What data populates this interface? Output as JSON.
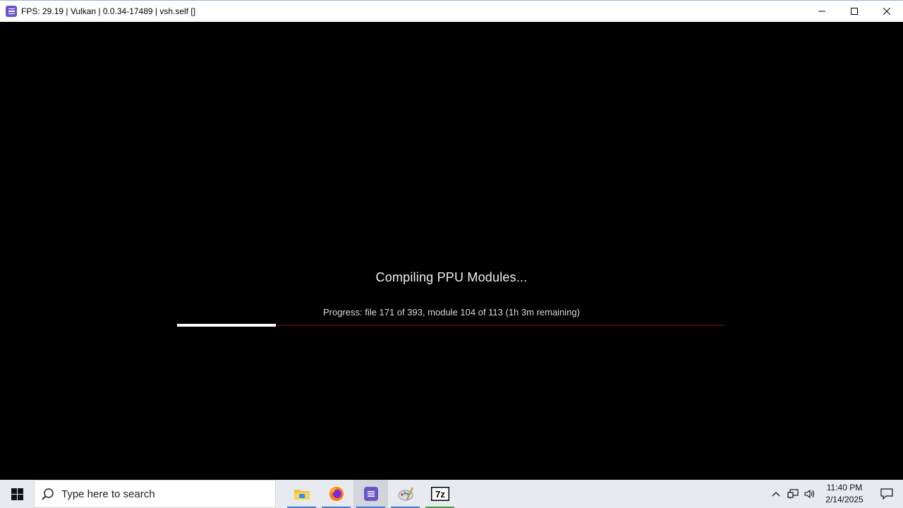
{
  "window": {
    "title": "FPS: 29.19 | Vulkan | 0.0.34-17489 | vsh.self []",
    "controls": [
      "minimize-icon",
      "maximize-icon",
      "close-icon"
    ]
  },
  "compile": {
    "heading": "Compiling PPU Modules...",
    "progress_text": "Progress: file 171 of 393, module 104 of 113 (1h  3m remaining)",
    "progress_fraction": 0.18,
    "bar_color": "#ffffff",
    "track_color": "#3a0a0e"
  },
  "taskbar": {
    "search_placeholder": "Type here to search",
    "apps": [
      {
        "name": "file-explorer-icon",
        "active": false
      },
      {
        "name": "firefox-icon",
        "active": false
      },
      {
        "name": "rpcs3-icon",
        "active": true
      },
      {
        "name": "paint-icon",
        "active": false
      },
      {
        "name": "7zip-icon",
        "active": false
      }
    ],
    "clock_time": "11:40 PM",
    "clock_date": "2/14/2025"
  },
  "colors": {
    "accent": "#3a78c9",
    "rpcs3": "#6b55c8",
    "seven_zip": "#3a9b3a"
  }
}
